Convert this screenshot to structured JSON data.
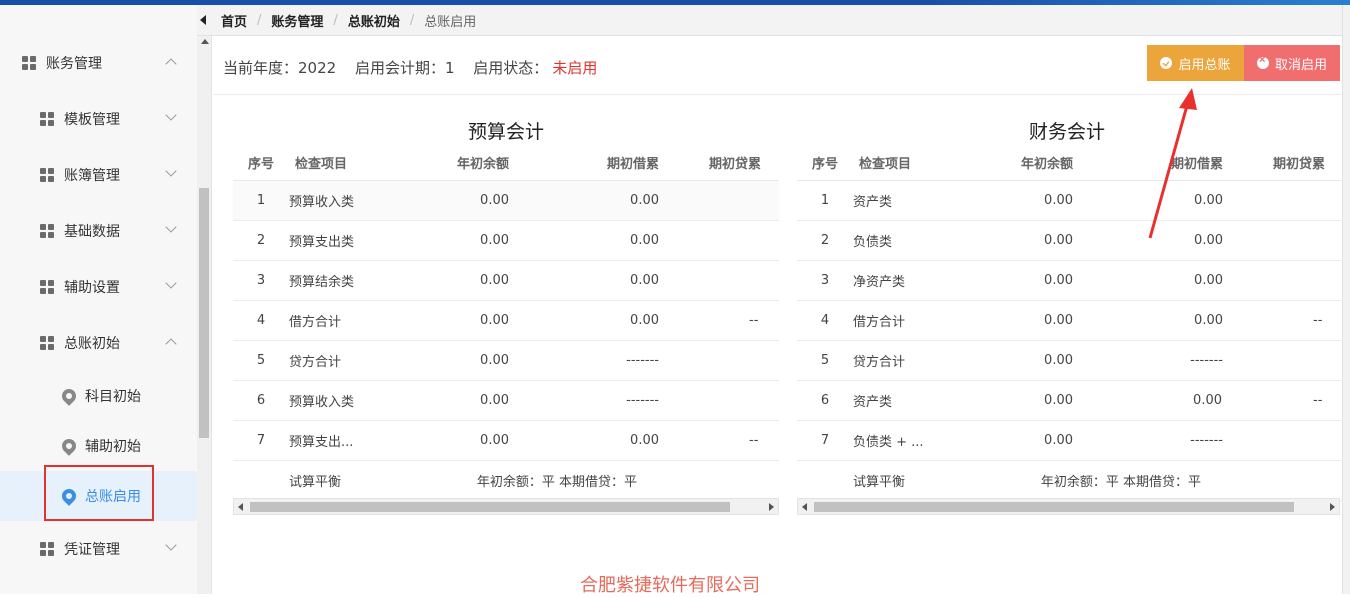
{
  "breadcrumb": [
    "首页",
    "账务管理",
    "总账初始",
    "总账启用"
  ],
  "sidebar": {
    "items": [
      {
        "label": "账务管理",
        "type": "group",
        "expanded": true
      },
      {
        "label": "模板管理",
        "type": "group",
        "expanded": false
      },
      {
        "label": "账簿管理",
        "type": "group",
        "expanded": false
      },
      {
        "label": "基础数据",
        "type": "group",
        "expanded": false
      },
      {
        "label": "辅助设置",
        "type": "group",
        "expanded": false
      },
      {
        "label": "总账初始",
        "type": "group",
        "expanded": true
      },
      {
        "label": "科目初始",
        "type": "leaf"
      },
      {
        "label": "辅助初始",
        "type": "leaf"
      },
      {
        "label": "总账启用",
        "type": "leaf",
        "active": true
      },
      {
        "label": "凭证管理",
        "type": "group",
        "expanded": false
      }
    ]
  },
  "status": {
    "year_label": "当前年度：2022",
    "period_label": "启用会计期：1",
    "state_prefix": "启用状态：",
    "state_value": "未启用"
  },
  "buttons": {
    "enable": "启用总账",
    "cancel": "取消启用"
  },
  "columns": [
    "序号",
    "检查项目",
    "年初余额",
    "期初借累",
    "期初贷累"
  ],
  "budget": {
    "title": "预算会计",
    "rows": [
      {
        "no": "1",
        "item": "预算收入类",
        "open": "0.00",
        "debit": "0.00",
        "credit": ""
      },
      {
        "no": "2",
        "item": "预算支出类",
        "open": "0.00",
        "debit": "0.00",
        "credit": ""
      },
      {
        "no": "3",
        "item": "预算结余类",
        "open": "0.00",
        "debit": "0.00",
        "credit": ""
      },
      {
        "no": "4",
        "item": "借方合计",
        "open": "0.00",
        "debit": "0.00",
        "credit": "--"
      },
      {
        "no": "5",
        "item": "贷方合计",
        "open": "0.00",
        "debit": "-------",
        "credit": ""
      },
      {
        "no": "6",
        "item": "预算收入类",
        "open": "0.00",
        "debit": "-------",
        "credit": ""
      },
      {
        "no": "7",
        "item": "预算支出...",
        "open": "0.00",
        "debit": "0.00",
        "credit": "--"
      }
    ],
    "balance_label": "试算平衡",
    "balance_result": "年初余额：平 本期借贷：平"
  },
  "finance": {
    "title": "财务会计",
    "rows": [
      {
        "no": "1",
        "item": "资产类",
        "open": "0.00",
        "debit": "0.00",
        "credit": ""
      },
      {
        "no": "2",
        "item": "负债类",
        "open": "0.00",
        "debit": "0.00",
        "credit": ""
      },
      {
        "no": "3",
        "item": "净资产类",
        "open": "0.00",
        "debit": "0.00",
        "credit": ""
      },
      {
        "no": "4",
        "item": "借方合计",
        "open": "0.00",
        "debit": "0.00",
        "credit": "--"
      },
      {
        "no": "5",
        "item": "贷方合计",
        "open": "0.00",
        "debit": "-------",
        "credit": ""
      },
      {
        "no": "6",
        "item": "资产类",
        "open": "0.00",
        "debit": "-------",
        "credit": "--"
      },
      {
        "no": "7",
        "item": "负债类 + ...",
        "open": "0.00",
        "debit": "-------",
        "credit": ""
      }
    ],
    "balance_label": "试算平衡",
    "balance_result": "年初余额：平 本期借贷：平"
  },
  "footer": {
    "company": "合肥紫捷软件有限公司"
  },
  "colors": {
    "accent": "#3a8ee6",
    "enable_btn": "#eba53a",
    "cancel_btn": "#f06e6e",
    "alert_red": "#e0322e"
  }
}
